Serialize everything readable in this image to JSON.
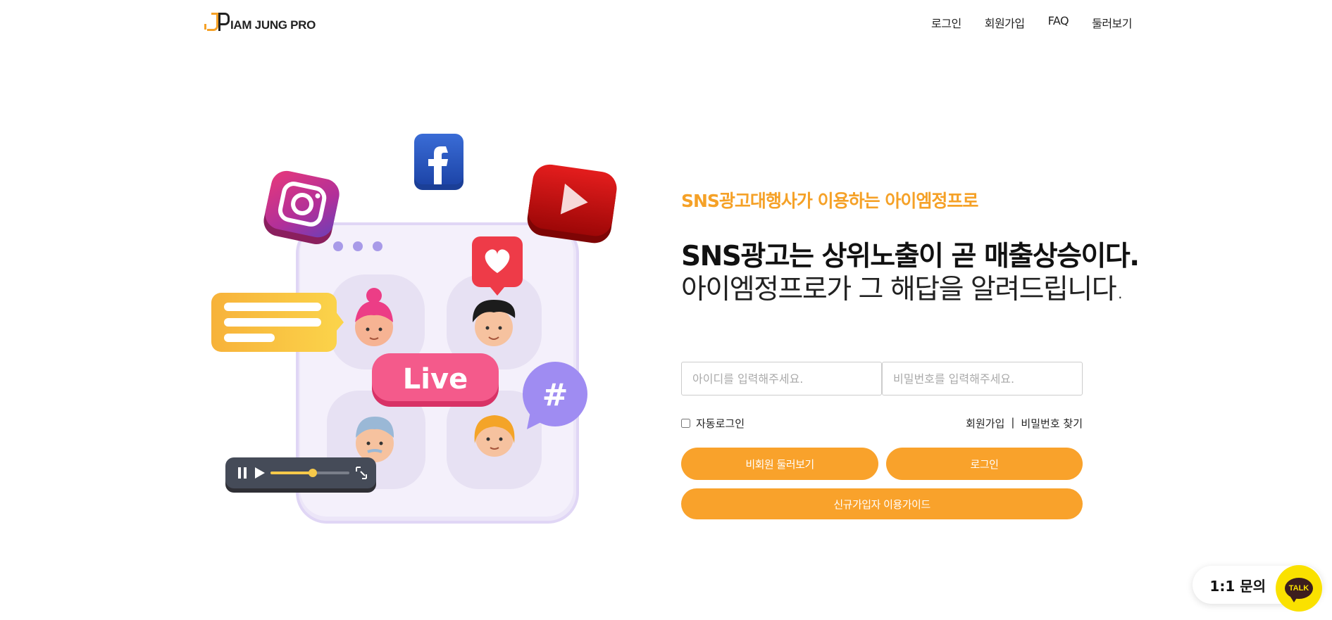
{
  "brand": {
    "logo_text": "IAM JUNG PRO"
  },
  "nav": {
    "login": "로그인",
    "signup": "회원가입",
    "faq": "FAQ",
    "browse": "둘러보기"
  },
  "hero": {
    "subtitle": "SNS광고대행사가 이용하는 아이엠정프로",
    "headline": "SNS광고는 상위노출이 곧 매출상승이다.",
    "headline2": "아이엠정프로가 그 해답을 알려드립니다.",
    "illustration": {
      "live_label": "Live",
      "hashtag": "#",
      "icons": [
        "facebook-icon",
        "instagram-icon",
        "youtube-icon",
        "heart-icon",
        "video-player-icon"
      ]
    }
  },
  "login_form": {
    "id_placeholder": "아이디를 입력해주세요.",
    "pw_placeholder": "비밀번호를 입력해주세요.",
    "auto_login_label": "자동로그인",
    "signup_link": "회원가입",
    "separator": "|",
    "find_pw_link": "비밀번호 찾기",
    "guest_button": "비회원 둘러보기",
    "login_button": "로그인",
    "guide_button": "신규가입자 이용가이드"
  },
  "chat_widget": {
    "label": "1:1 문의",
    "talk_text": "TALK"
  },
  "colors": {
    "accent": "#f9a22b",
    "kakao_yellow": "#fae100",
    "kakao_brown": "#3c1e1e"
  }
}
